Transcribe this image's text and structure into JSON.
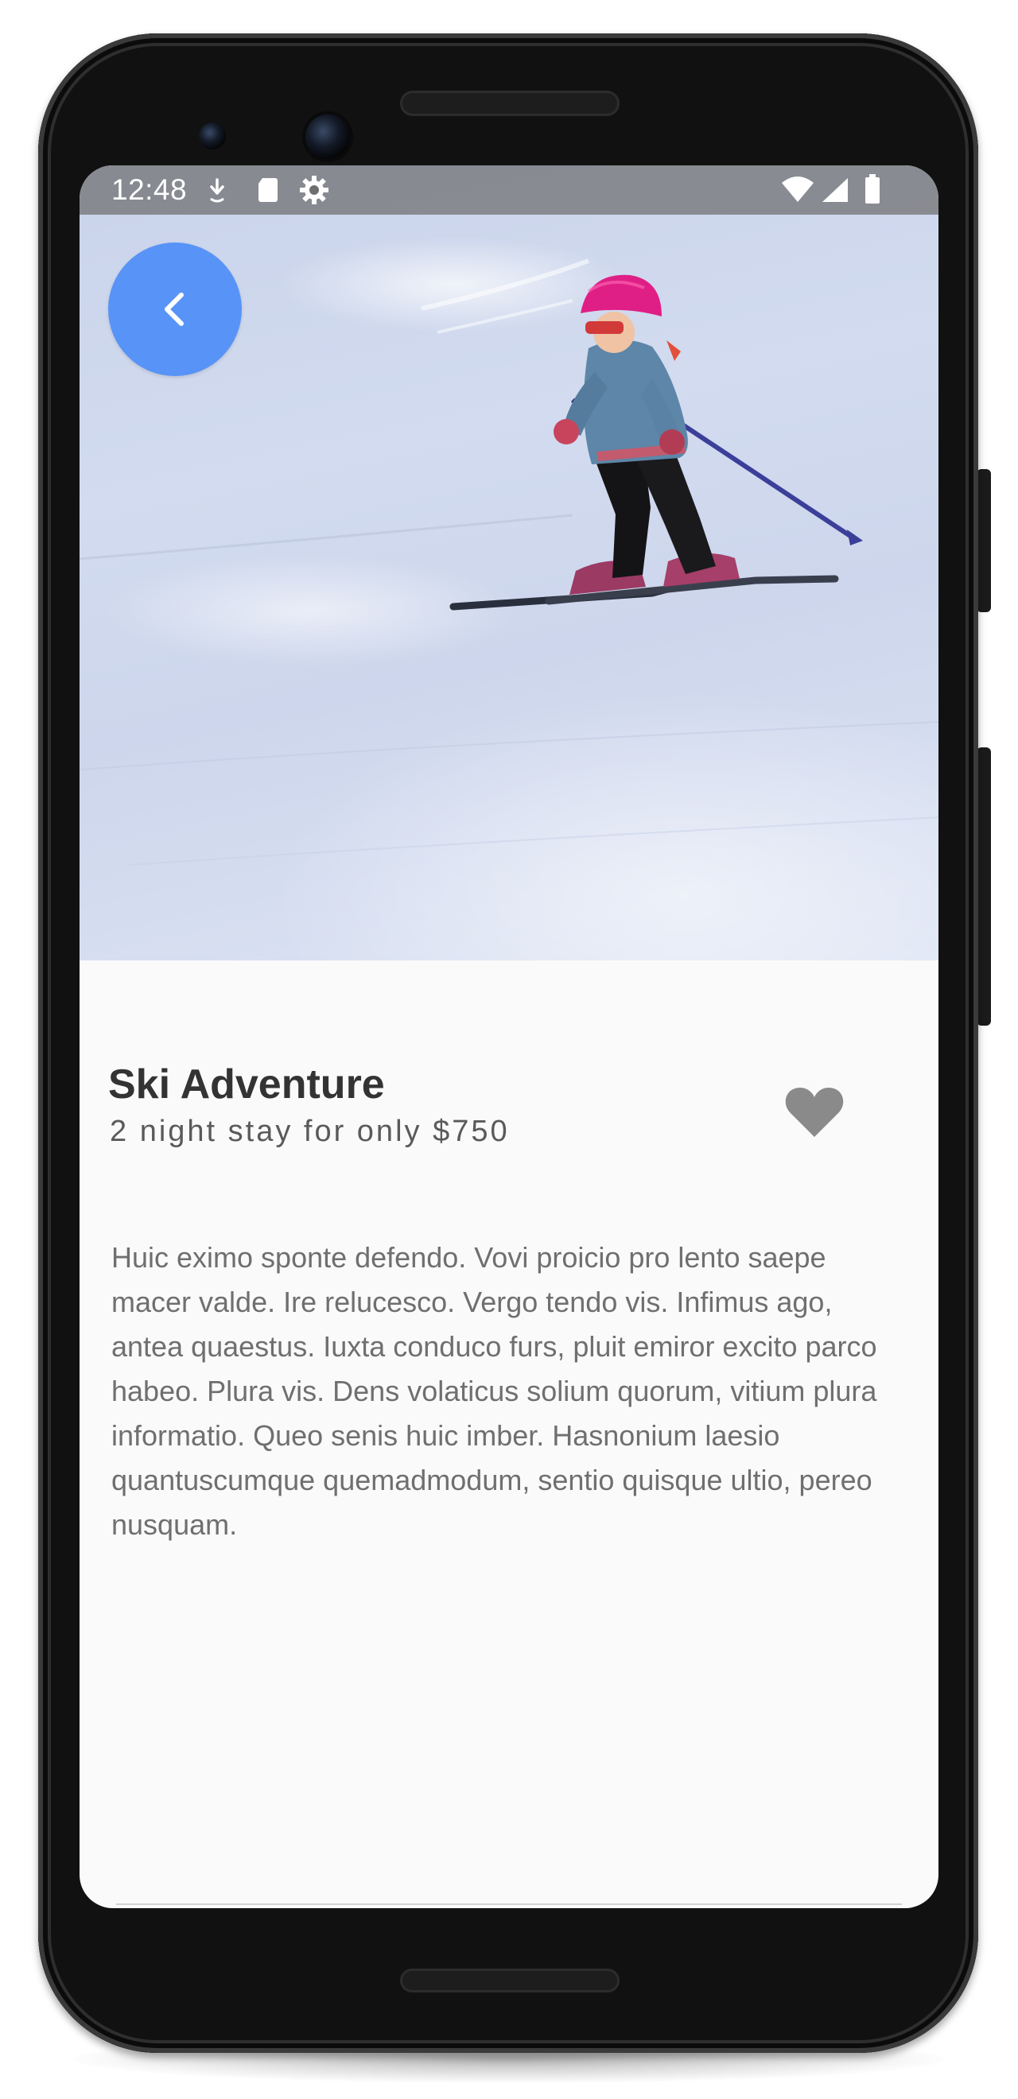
{
  "status_bar": {
    "time": "12:48",
    "left_icons": [
      "download-icon",
      "sd-card-icon",
      "settings-gear-icon"
    ],
    "right_icons": [
      "wifi-icon",
      "cell-signal-icon",
      "battery-icon"
    ]
  },
  "hero": {
    "image": "skier-child-on-snowy-slope"
  },
  "header": {
    "back_icon": "chevron-left-icon",
    "back_button_color": "#5893f7"
  },
  "detail": {
    "title": "Ski Adventure",
    "subtitle": "2 night stay for only $750",
    "favorite_icon": "heart-icon",
    "description": "Huic eximo sponte defendo. Vovi proicio pro lento saepe macer valde. Ire relucesco. Vergo tendo vis. Infimus ago, antea quaestus. Iuxta conduco furs, pluit emiror excito parco habeo. Plura vis. Dens volaticus solium quorum, vitium plura informatio. Queo senis huic imber. Hasnonium laesio quantuscumque quemadmodum, sentio quisque ultio, pereo nusquam."
  }
}
